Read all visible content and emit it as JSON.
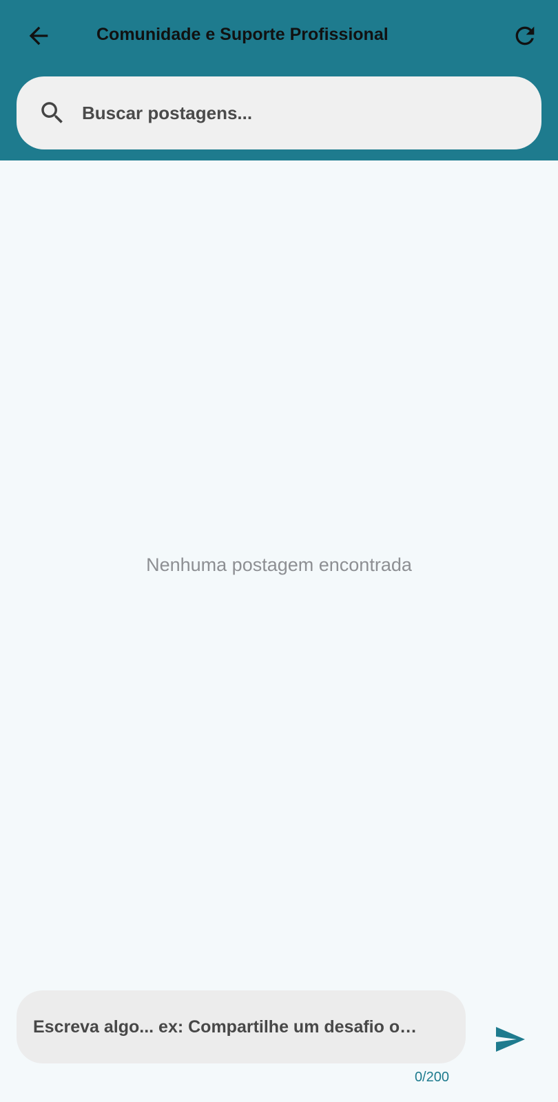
{
  "header": {
    "title": "Comunidade e Suporte Profissional",
    "back_icon": "arrow-back-icon",
    "refresh_icon": "refresh-icon",
    "background_color": "#1e7b8e"
  },
  "search": {
    "placeholder": "Buscar postagens...",
    "value": "",
    "icon": "search-icon"
  },
  "feed": {
    "empty_message": "Nenhuma postagem encontrada"
  },
  "composer": {
    "placeholder": "Escreva algo... ex: Compartilhe um desafio o…",
    "value": "",
    "counter": "0/200",
    "send_icon": "send-icon",
    "accent_color": "#1e7b8e"
  }
}
